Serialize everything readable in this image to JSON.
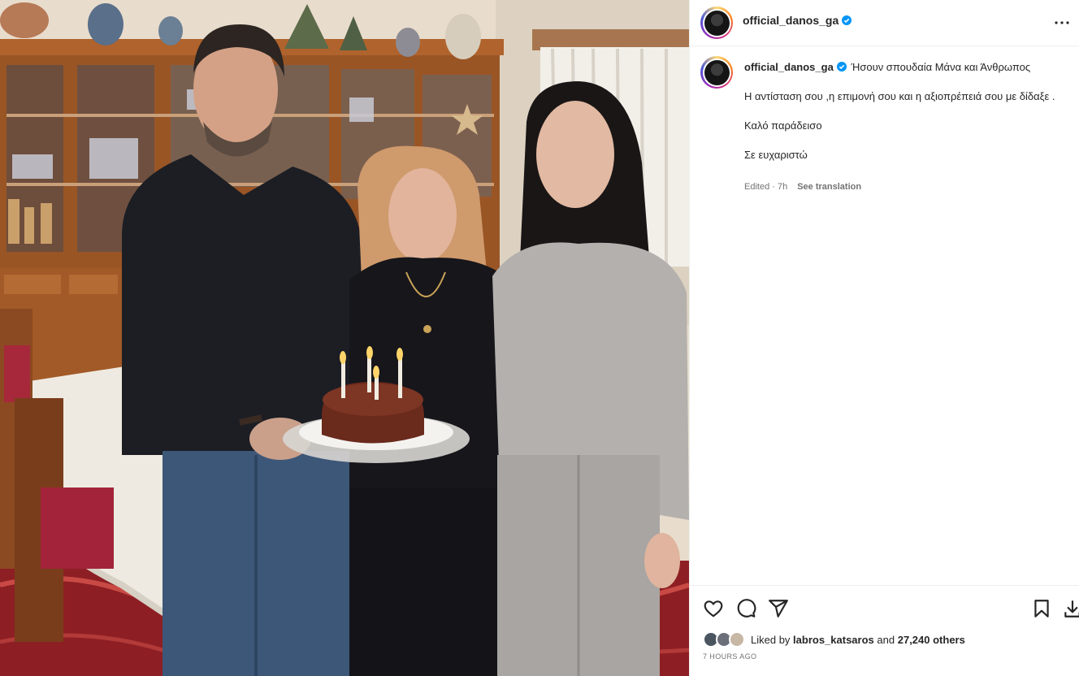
{
  "post": {
    "username": "official_danos_ga",
    "verified": true,
    "more_label": "More options"
  },
  "photo": {
    "alt": "Three people in a dining room holding a birthday cake with lit candles"
  },
  "caption": {
    "username": "official_danos_ga",
    "first_line": "Ήσουν σπουδαία Μάνα και Άνθρωπος",
    "line2": "Η αντίσταση σου ,η επιμονή σου και η αξιοπρέπειά σου με δίδαξε .",
    "line3": "Καλό παράδεισο",
    "line4": "Σε ευχαριστώ",
    "edited": "Edited · 7h",
    "see_translation": "See translation"
  },
  "actions": {
    "liked_by_prefix": "Liked by",
    "liked_by_user": "labros_katsaros",
    "and": "and",
    "others": "27,240 others",
    "timestamp": "7 HOURS AGO"
  },
  "colors": {
    "verified_blue": "#0095f6",
    "meta_gray": "#737373",
    "border": "#efefef"
  }
}
